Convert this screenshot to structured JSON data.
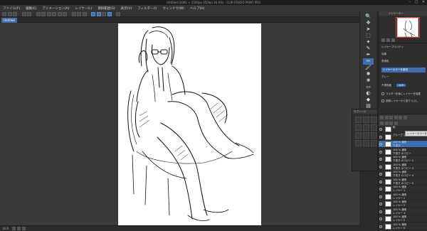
{
  "window": {
    "title": "Untitled (1061 × 1500px 350dpi 16.9%) - CLIP STUDIO PAINT PRO",
    "minimize_label": "–",
    "maximize_label": "□",
    "close_label": "✕"
  },
  "menu": {
    "items": [
      "ファイル(F)",
      "編集(E)",
      "アニメーション(A)",
      "レイヤー(L)",
      "選択範囲(S)",
      "表示(V)",
      "フィルター(I)",
      "ウィンドウ(W)",
      "ヘルプ(H)"
    ]
  },
  "canvas_tab": {
    "label": "Untitled"
  },
  "status": {
    "zoom": "16.9"
  },
  "tools": {
    "items": [
      {
        "icon": "zoom-icon",
        "glyph": "🔍"
      },
      {
        "icon": "move-icon",
        "glyph": "✥"
      },
      {
        "icon": "operation-icon",
        "glyph": "➤"
      },
      {
        "icon": "selection-icon",
        "glyph": "⬚"
      },
      {
        "icon": "auto-select-icon",
        "glyph": "✦"
      },
      {
        "icon": "eyedropper-icon",
        "glyph": "✎"
      },
      {
        "icon": "pen-icon",
        "glyph": "✒"
      },
      {
        "icon": "pencil-icon",
        "glyph": "✏"
      },
      {
        "icon": "brush-icon",
        "glyph": "🖌"
      },
      {
        "icon": "airbrush-icon",
        "glyph": "✺"
      },
      {
        "icon": "decoration-icon",
        "glyph": "❀"
      },
      {
        "icon": "eraser-icon",
        "glyph": "▭"
      },
      {
        "icon": "blend-icon",
        "glyph": "◐"
      },
      {
        "icon": "fill-icon",
        "glyph": "◆"
      },
      {
        "icon": "gradient-icon",
        "glyph": "▤"
      }
    ],
    "active_index": 7
  },
  "navigator": {
    "header": "ナビゲーター"
  },
  "layer_property": {
    "header": "レイヤープロパティ",
    "effect_label": "効果",
    "expression_label": "表現色",
    "selected_option": "レイヤーカラーを使用",
    "color_label": "グレー",
    "opacity_label": "不透明度",
    "opacity_value": "100",
    "check1": "ラスター化後にレイヤーを保護",
    "check2": "参照レイヤーから塗りつぶし"
  },
  "sub_tool": {
    "header": "サブツール"
  },
  "layer_panel": {
    "tooltip": "レイヤーカラーを変更",
    "layers": [
      {
        "name": "紙",
        "sub": "",
        "selected": false
      },
      {
        "name": "グループ 1",
        "sub": "",
        "selected": false
      },
      {
        "name": "100 % 通常",
        "sub": "下書き",
        "selected": true
      },
      {
        "name": "100 % 通常",
        "sub": "下書き のコピー",
        "selected": false
      },
      {
        "name": "100 % 通常",
        "sub": "下書き のコピー 2",
        "selected": false
      },
      {
        "name": "100 % 通常",
        "sub": "下書き のコピー 3",
        "selected": false
      },
      {
        "name": "100 % 通常",
        "sub": "下書き のコピー 4",
        "selected": false
      },
      {
        "name": "100 % 通常",
        "sub": "下書き のコピー 5",
        "selected": false
      },
      {
        "name": "100 % 通常",
        "sub": "レイヤー 1",
        "selected": false
      },
      {
        "name": "100 % 通常",
        "sub": "レイヤー 2",
        "selected": false
      },
      {
        "name": "100 % 通常",
        "sub": "レイヤー 3",
        "selected": false
      },
      {
        "name": "100 % 通常",
        "sub": "レイヤー 4",
        "selected": false
      },
      {
        "name": "100 % 通常",
        "sub": "レイヤー 5",
        "selected": false
      },
      {
        "name": "100 % 通常",
        "sub": "レイヤー 6",
        "selected": false
      }
    ]
  },
  "colors": {
    "accent": "#3d6fb3",
    "tooltip_bg": "#dddddd",
    "nav_frame": "#ee3333",
    "main_color": "#000000",
    "sub_color": "#ffffff"
  }
}
